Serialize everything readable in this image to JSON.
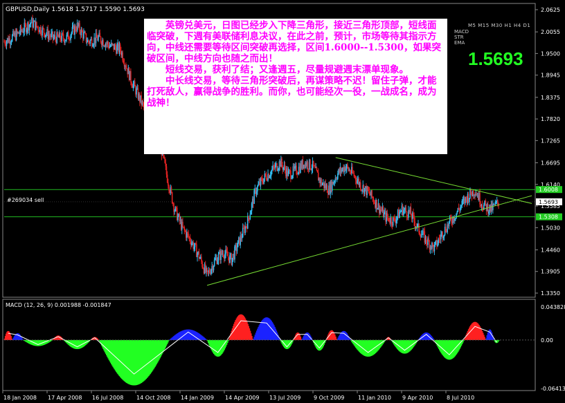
{
  "header": {
    "symbol": "GBPUSD,Daily",
    "ohlc": "1.5618 1.5717 1.5590 1.5693"
  },
  "order_label": "#269034 sell",
  "current_price_big": "1.5693",
  "timeframes": "M5 M15 M30 H1 H4 D1",
  "indicator_names": [
    "MACD",
    "STR",
    "EMA"
  ],
  "note": {
    "p1": "英镑兑美元，日图已经步入下降三角形，接近三角形顶部，短线面临突破，下週有美联储利息决议，在此之前，预计，市场等待其指示方向，中线还需要等待区间突破再选择，区间1.6000--1.5300，如果突破区间，中线方向也随之而出！",
    "p2": "短线交易，获利了结；又逢週五，尽量规避週末漂单现象。",
    "p3": "中长线交易，等待三角形突破后，再谋策略不迟！留住子弹，才能打死敌人，赢得战争的胜利。而你，也可能经次一役，一战成名，成为战神！"
  },
  "colors": {
    "up": "#33bbee",
    "down": "#dd2222",
    "hline": "#22bb22",
    "trend": "#77dd33",
    "macd_pos_red": "#ff2020",
    "macd_pos_blue": "#1a22ff",
    "macd_neg_green": "#22ff22",
    "price_tag": "#22cc22"
  },
  "chart_data": [
    {
      "type": "candlestick",
      "title": "GBPUSD,Daily",
      "y_ticks": [
        "2.0625",
        "2.0055",
        "1.9500",
        "1.8945",
        "1.8375",
        "1.7820",
        "1.7265",
        "1.6695",
        "1.6140",
        "1.5585",
        "1.5030",
        "1.4460",
        "1.3905",
        "1.3350"
      ],
      "x_ticks": [
        "18 Jan 2008",
        "17 Apr 2008",
        "16 Jul 2008",
        "14 Oct 2008",
        "14 Jan 2009",
        "14 Apr 2009",
        "13 Jul 2009",
        "9 Oct 2009",
        "11 Jan 2010",
        "9 Apr 2010",
        "8 Jul 2010"
      ],
      "ylim": [
        1.335,
        2.0625
      ],
      "price_tags": [
        "1.6008",
        "1.5693",
        "1.5308"
      ],
      "horizontal_levels": [
        1.6008,
        1.5308
      ],
      "current_price": 1.5693,
      "series_path": [
        [
          0,
          1.98
        ],
        [
          10,
          2.0
        ],
        [
          20,
          2.03
        ],
        [
          28,
          2.01
        ],
        [
          36,
          1.99
        ],
        [
          46,
          1.99
        ],
        [
          54,
          2.02
        ],
        [
          62,
          1.98
        ],
        [
          70,
          1.99
        ],
        [
          78,
          1.97
        ],
        [
          86,
          1.96
        ],
        [
          94,
          1.88
        ],
        [
          102,
          1.82
        ],
        [
          108,
          1.78
        ],
        [
          114,
          1.74
        ],
        [
          120,
          1.64
        ],
        [
          126,
          1.55
        ],
        [
          132,
          1.5
        ],
        [
          138,
          1.47
        ],
        [
          144,
          1.43
        ],
        [
          150,
          1.38
        ],
        [
          156,
          1.42
        ],
        [
          162,
          1.44
        ],
        [
          168,
          1.42
        ],
        [
          174,
          1.47
        ],
        [
          180,
          1.52
        ],
        [
          186,
          1.6
        ],
        [
          192,
          1.63
        ],
        [
          198,
          1.65
        ],
        [
          204,
          1.67
        ],
        [
          210,
          1.64
        ],
        [
          216,
          1.65
        ],
        [
          222,
          1.67
        ],
        [
          228,
          1.66
        ],
        [
          234,
          1.62
        ],
        [
          240,
          1.6
        ],
        [
          246,
          1.64
        ],
        [
          252,
          1.66
        ],
        [
          258,
          1.64
        ],
        [
          264,
          1.61
        ],
        [
          270,
          1.59
        ],
        [
          276,
          1.56
        ],
        [
          282,
          1.53
        ],
        [
          288,
          1.52
        ],
        [
          294,
          1.55
        ],
        [
          300,
          1.54
        ],
        [
          306,
          1.5
        ],
        [
          312,
          1.47
        ],
        [
          318,
          1.45
        ],
        [
          324,
          1.49
        ],
        [
          330,
          1.52
        ],
        [
          336,
          1.55
        ],
        [
          342,
          1.58
        ],
        [
          348,
          1.6
        ],
        [
          354,
          1.56
        ],
        [
          360,
          1.55
        ],
        [
          366,
          1.57
        ]
      ],
      "trendlines": [
        {
          "from": [
            150,
            1.355
          ],
          "to": [
            390,
            1.585
          ]
        },
        {
          "from": [
            245,
            1.683
          ],
          "to": [
            390,
            1.565
          ]
        }
      ]
    },
    {
      "type": "bar",
      "title": "MACD (12, 26, 9) 0.001988 -0.001847",
      "y_ticks": [
        "0.043828",
        "0.00",
        "-0.064130"
      ],
      "ylim": [
        -0.06413,
        0.043828
      ],
      "segments": [
        {
          "color": "red",
          "from": 0,
          "to": 6,
          "peak": 0.012
        },
        {
          "color": "blue",
          "from": 6,
          "to": 14,
          "peak": 0.009
        },
        {
          "color": "green",
          "from": 14,
          "to": 36,
          "peak": -0.008
        },
        {
          "color": "red",
          "from": 36,
          "to": 44,
          "peak": 0.006
        },
        {
          "color": "green",
          "from": 44,
          "to": 64,
          "peak": -0.012
        },
        {
          "color": "red",
          "from": 64,
          "to": 70,
          "peak": 0.004
        },
        {
          "color": "green",
          "from": 70,
          "to": 122,
          "peak": -0.06
        },
        {
          "color": "blue",
          "from": 122,
          "to": 150,
          "peak": 0.014
        },
        {
          "color": "green",
          "from": 150,
          "to": 166,
          "peak": -0.022
        },
        {
          "color": "red",
          "from": 166,
          "to": 184,
          "peak": 0.034
        },
        {
          "color": "blue",
          "from": 184,
          "to": 204,
          "peak": 0.03
        },
        {
          "color": "green",
          "from": 204,
          "to": 214,
          "peak": -0.012
        },
        {
          "color": "red",
          "from": 214,
          "to": 220,
          "peak": 0.01
        },
        {
          "color": "blue",
          "from": 220,
          "to": 228,
          "peak": 0.01
        },
        {
          "color": "green",
          "from": 228,
          "to": 238,
          "peak": -0.014
        },
        {
          "color": "red",
          "from": 238,
          "to": 246,
          "peak": 0.013
        },
        {
          "color": "blue",
          "from": 246,
          "to": 256,
          "peak": 0.012
        },
        {
          "color": "green",
          "from": 256,
          "to": 282,
          "peak": -0.022
        },
        {
          "color": "red",
          "from": 282,
          "to": 286,
          "peak": 0.004
        },
        {
          "color": "green",
          "from": 286,
          "to": 306,
          "peak": -0.018
        },
        {
          "color": "blue",
          "from": 306,
          "to": 318,
          "peak": 0.01
        },
        {
          "color": "green",
          "from": 318,
          "to": 340,
          "peak": -0.026
        },
        {
          "color": "red",
          "from": 340,
          "to": 356,
          "peak": 0.024
        },
        {
          "color": "blue",
          "from": 356,
          "to": 362,
          "peak": 0.014
        },
        {
          "color": "green",
          "from": 362,
          "to": 366,
          "peak": -0.004
        }
      ]
    }
  ]
}
